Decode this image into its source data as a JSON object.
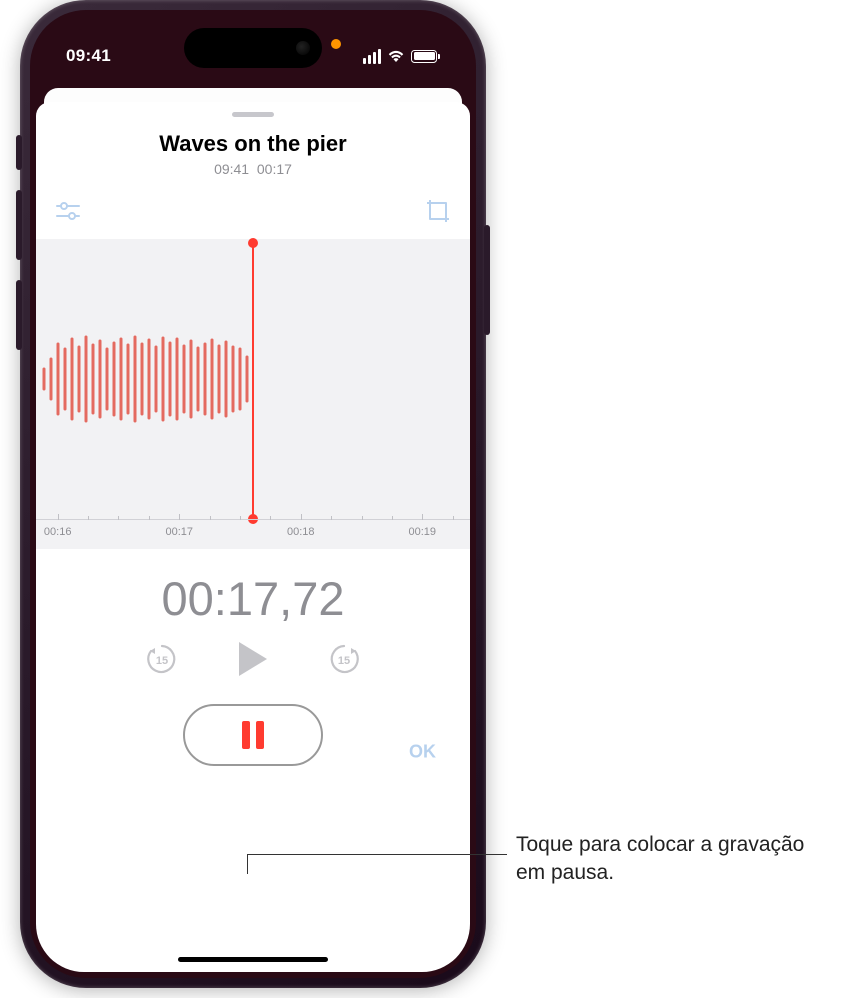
{
  "status": {
    "time": "09:41",
    "recording_indicator_color": "#ff9500"
  },
  "recording": {
    "title": "Waves on the pier",
    "meta_time": "09:41",
    "meta_duration": "00:17",
    "elapsed": "00:17,72"
  },
  "timeline": {
    "ticks": [
      "00:16",
      "00:17",
      "00:18",
      "00:19"
    ]
  },
  "buttons": {
    "ok_label": "OK",
    "skip_back_seconds": "15",
    "skip_fwd_seconds": "15"
  },
  "callout": {
    "text": "Toque para colocar a gravação em pausa."
  },
  "colors": {
    "accent": "#ff3b30",
    "disabled": "#c4c4c8",
    "tool_tint": "#b7d1ee"
  }
}
